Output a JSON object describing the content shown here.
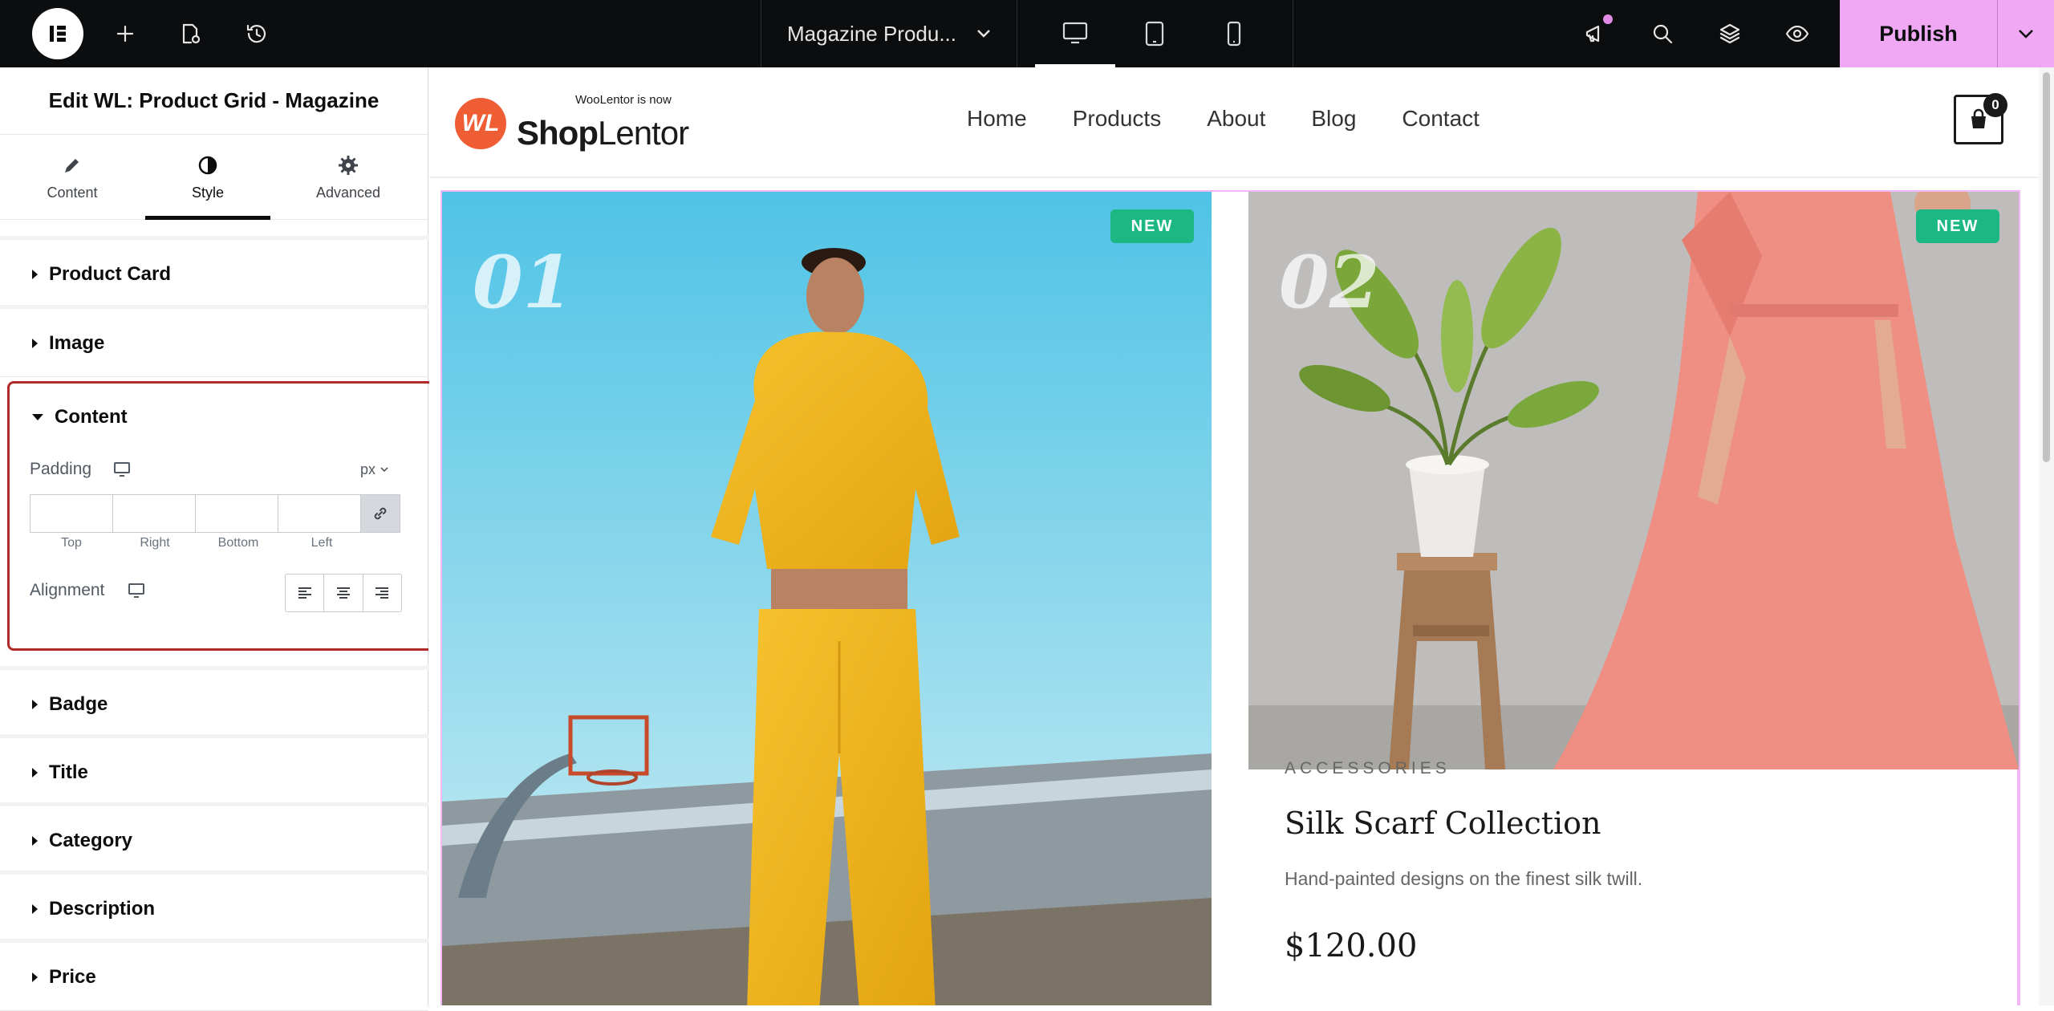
{
  "topbar": {
    "doc_title": "Magazine Produ...",
    "publish_label": "Publish",
    "accent": "#f0a8f4"
  },
  "panel": {
    "title": "Edit WL: Product Grid - Magazine",
    "tabs": [
      {
        "label": "Content",
        "icon": "pencil-icon"
      },
      {
        "label": "Style",
        "icon": "contrast-icon"
      },
      {
        "label": "Advanced",
        "icon": "gear-icon"
      }
    ],
    "active_tab": "Style",
    "sections": {
      "product_card": "Product Card",
      "image": "Image",
      "content": "Content",
      "badge": "Badge",
      "title": "Title",
      "category": "Category",
      "description": "Description",
      "price": "Price"
    },
    "content_controls": {
      "padding_label": "Padding",
      "unit": "px",
      "padding_fields": [
        "Top",
        "Right",
        "Bottom",
        "Left"
      ],
      "alignment_label": "Alignment"
    },
    "highlight_color": "#b12a2a"
  },
  "site": {
    "brand_small": "WooLentor is now",
    "brand_bold": "Shop",
    "brand_rest": "Lentor",
    "brand_mark": "WL",
    "nav": [
      "Home",
      "Products",
      "About",
      "Blog",
      "Contact"
    ],
    "cart_count": "0"
  },
  "products": [
    {
      "number": "01",
      "badge": "NEW"
    },
    {
      "number": "02",
      "badge": "NEW",
      "category": "ACCESSORIES",
      "title": "Silk Scarf Collection",
      "description": "Hand-painted designs on the finest silk twill.",
      "price": "$120.00"
    }
  ]
}
